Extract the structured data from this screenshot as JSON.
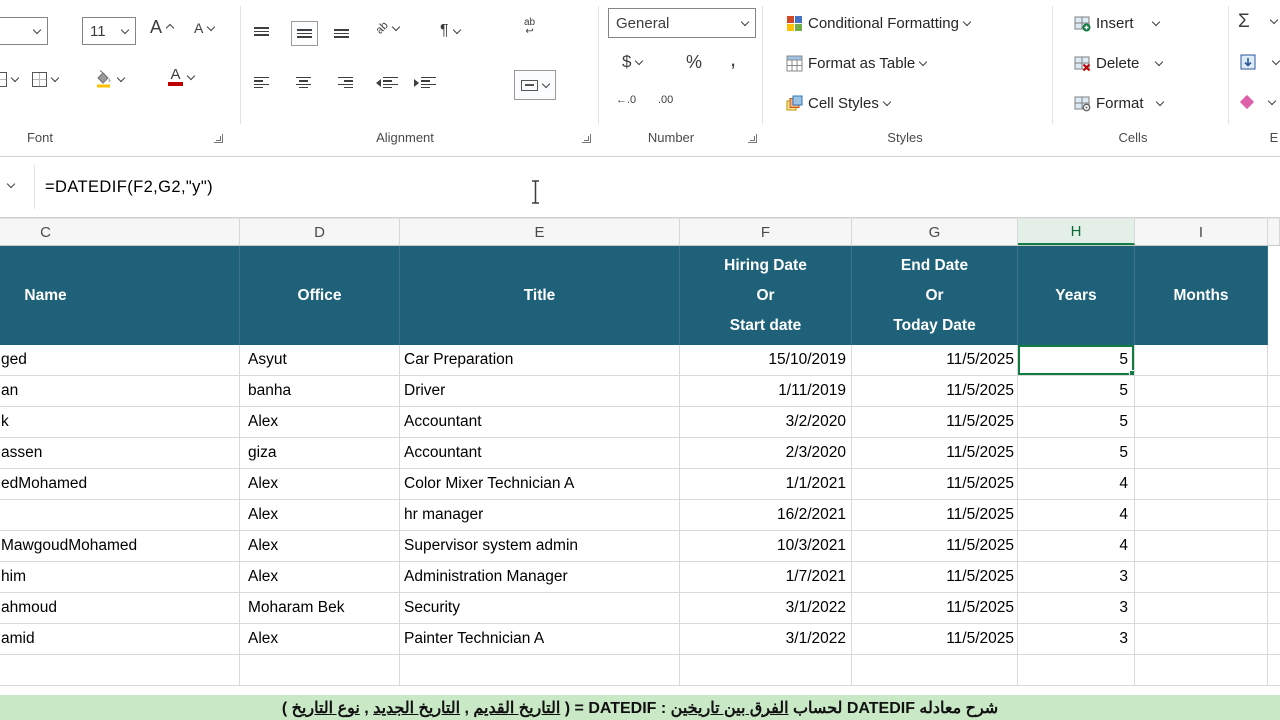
{
  "ribbon": {
    "labels": {
      "font": "Font",
      "alignment": "Alignment",
      "number": "Number",
      "styles": "Styles",
      "cells": "Cells",
      "editing": "E"
    },
    "font": {
      "size": "11"
    },
    "glyphs": {
      "grow": "A",
      "shrink": "A",
      "font_color": "A",
      "orient": "ab",
      "pilcrow": "¶",
      "wrap_top": "ab",
      "wrap_bottom": "↩",
      "dollar": "$",
      "percent": "%",
      "comma": ",",
      "dec_inc": "←.0",
      "dec_dec": ".00",
      "autosum": "Σ"
    },
    "number": {
      "format_selected": "General"
    },
    "styles": {
      "conditional_formatting": "Conditional Formatting",
      "format_as_table": "Format as Table",
      "cell_styles": "Cell Styles"
    },
    "cells": {
      "insert": "Insert",
      "delete": "Delete",
      "format": "Format"
    }
  },
  "formula_bar": {
    "formula": "=DATEDIF(F2,G2,\"y\")"
  },
  "columns": [
    "C",
    "D",
    "E",
    "F",
    "G",
    "H",
    "I"
  ],
  "table": {
    "header": {
      "c": "Name",
      "d": "Office",
      "e": "Title",
      "f": [
        "Hiring Date",
        "Or",
        "Start date"
      ],
      "g": [
        "End Date",
        "Or",
        "Today Date"
      ],
      "h": "Years",
      "i": "Months"
    },
    "rows": [
      {
        "c": "ged",
        "d": "Asyut",
        "e": "Car Preparation",
        "f": "15/10/2019",
        "g": "11/5/2025",
        "h": "5",
        "i": ""
      },
      {
        "c": "an",
        "d": "banha",
        "e": "Driver",
        "f": "1/11/2019",
        "g": "11/5/2025",
        "h": "5",
        "i": ""
      },
      {
        "c": "k",
        "d": "Alex",
        "e": "Accountant",
        "f": "3/2/2020",
        "g": "11/5/2025",
        "h": "5",
        "i": ""
      },
      {
        "c": "assen",
        "d": "giza",
        "e": "Accountant",
        "f": "2/3/2020",
        "g": "11/5/2025",
        "h": "5",
        "i": ""
      },
      {
        "c": "edMohamed",
        "d": "Alex",
        "e": "Color Mixer Technician A",
        "f": "1/1/2021",
        "g": "11/5/2025",
        "h": "4",
        "i": ""
      },
      {
        "c": "",
        "d": "Alex",
        "e": "hr manager",
        "f": "16/2/2021",
        "g": "11/5/2025",
        "h": "4",
        "i": ""
      },
      {
        "c": "MawgoudMohamed",
        "d": "Alex",
        "e": "Supervisor system admin",
        "f": "10/3/2021",
        "g": "11/5/2025",
        "h": "4",
        "i": ""
      },
      {
        "c": "him",
        "d": "Alex",
        "e": "Administration Manager",
        "f": "1/7/2021",
        "g": "11/5/2025",
        "h": "3",
        "i": ""
      },
      {
        "c": "ahmoud",
        "d": "Moharam Bek",
        "e": "Security",
        "f": "3/1/2022",
        "g": "11/5/2025",
        "h": "3",
        "i": ""
      },
      {
        "c": "amid",
        "d": "Alex",
        "e": "Painter Technician A",
        "f": "3/1/2022",
        "g": "11/5/2025",
        "h": "3",
        "i": ""
      }
    ]
  },
  "banner": {
    "segments": [
      {
        "t": "شرح معادله "
      },
      {
        "t": "DATEDIF",
        "latin": true
      },
      {
        "t": " لحساب "
      },
      {
        "t": "الفرق بين تاريخين",
        "u": true
      },
      {
        "t": " : "
      },
      {
        "t": "DATEDIF",
        "latin": true
      },
      {
        "t": " = ( "
      },
      {
        "t": "التاريخ القديم",
        "u": true
      },
      {
        "t": " , "
      },
      {
        "t": "التاريخ الجديد",
        "u": true
      },
      {
        "t": " , "
      },
      {
        "t": "نوع التاريخ",
        "u": true
      },
      {
        "t": " )"
      }
    ]
  },
  "colors": {
    "header_bg": "#1E6178",
    "selection_green": "#107C41",
    "banner_bg": "#C9E8C5",
    "font_color_red": "#C00000",
    "fill_color_yellow": "#FFC000"
  }
}
